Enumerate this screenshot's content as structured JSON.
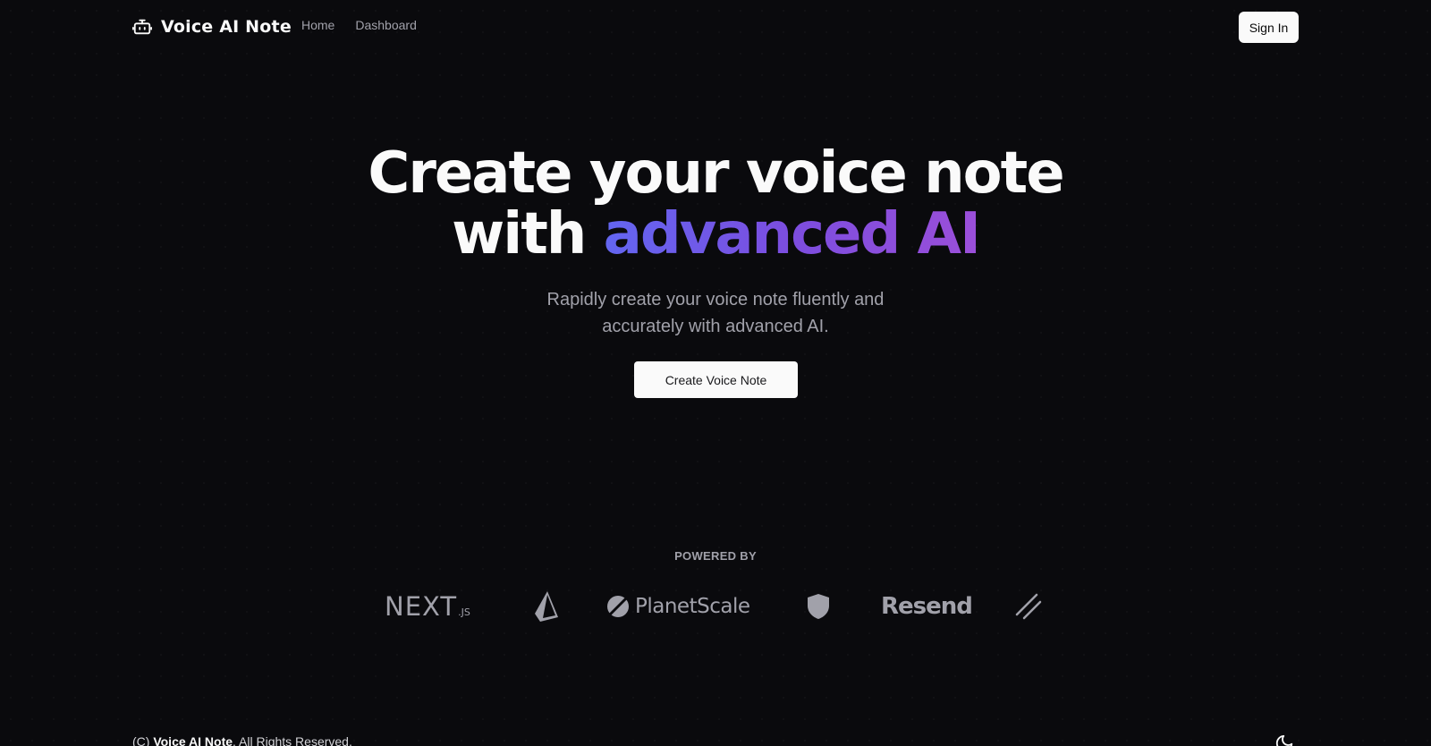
{
  "header": {
    "brand": "Voice AI Note",
    "nav": [
      {
        "label": "Home"
      },
      {
        "label": "Dashboard"
      }
    ],
    "signin_label": "Sign In"
  },
  "hero": {
    "headline_line1": "Create your voice note",
    "headline_line2_prefix": "with ",
    "headline_line2_highlight": "advanced AI",
    "subtitle": "Rapidly create your voice note fluently and accurately with advanced AI.",
    "cta_label": "Create Voice Note"
  },
  "powered_by": {
    "label": "POWERED BY",
    "logos": [
      {
        "name": "nextjs-logo",
        "text": "NEXT",
        "suffix": ".JS"
      },
      {
        "name": "prisma-logo"
      },
      {
        "name": "planetscale-logo",
        "text": "PlanetScale"
      },
      {
        "name": "shield-logo"
      },
      {
        "name": "resend-logo",
        "text": "Resend"
      },
      {
        "name": "slash-logo"
      }
    ]
  },
  "footer": {
    "copyright_prefix": "(C) ",
    "copyright_brand": "Voice AI Note",
    "copyright_suffix": ". All Rights Reserved."
  },
  "colors": {
    "background": "#0a0a0d",
    "gradient_start": "#6366f1",
    "gradient_end": "#9b4fd9",
    "muted_text": "#a1a1aa"
  }
}
